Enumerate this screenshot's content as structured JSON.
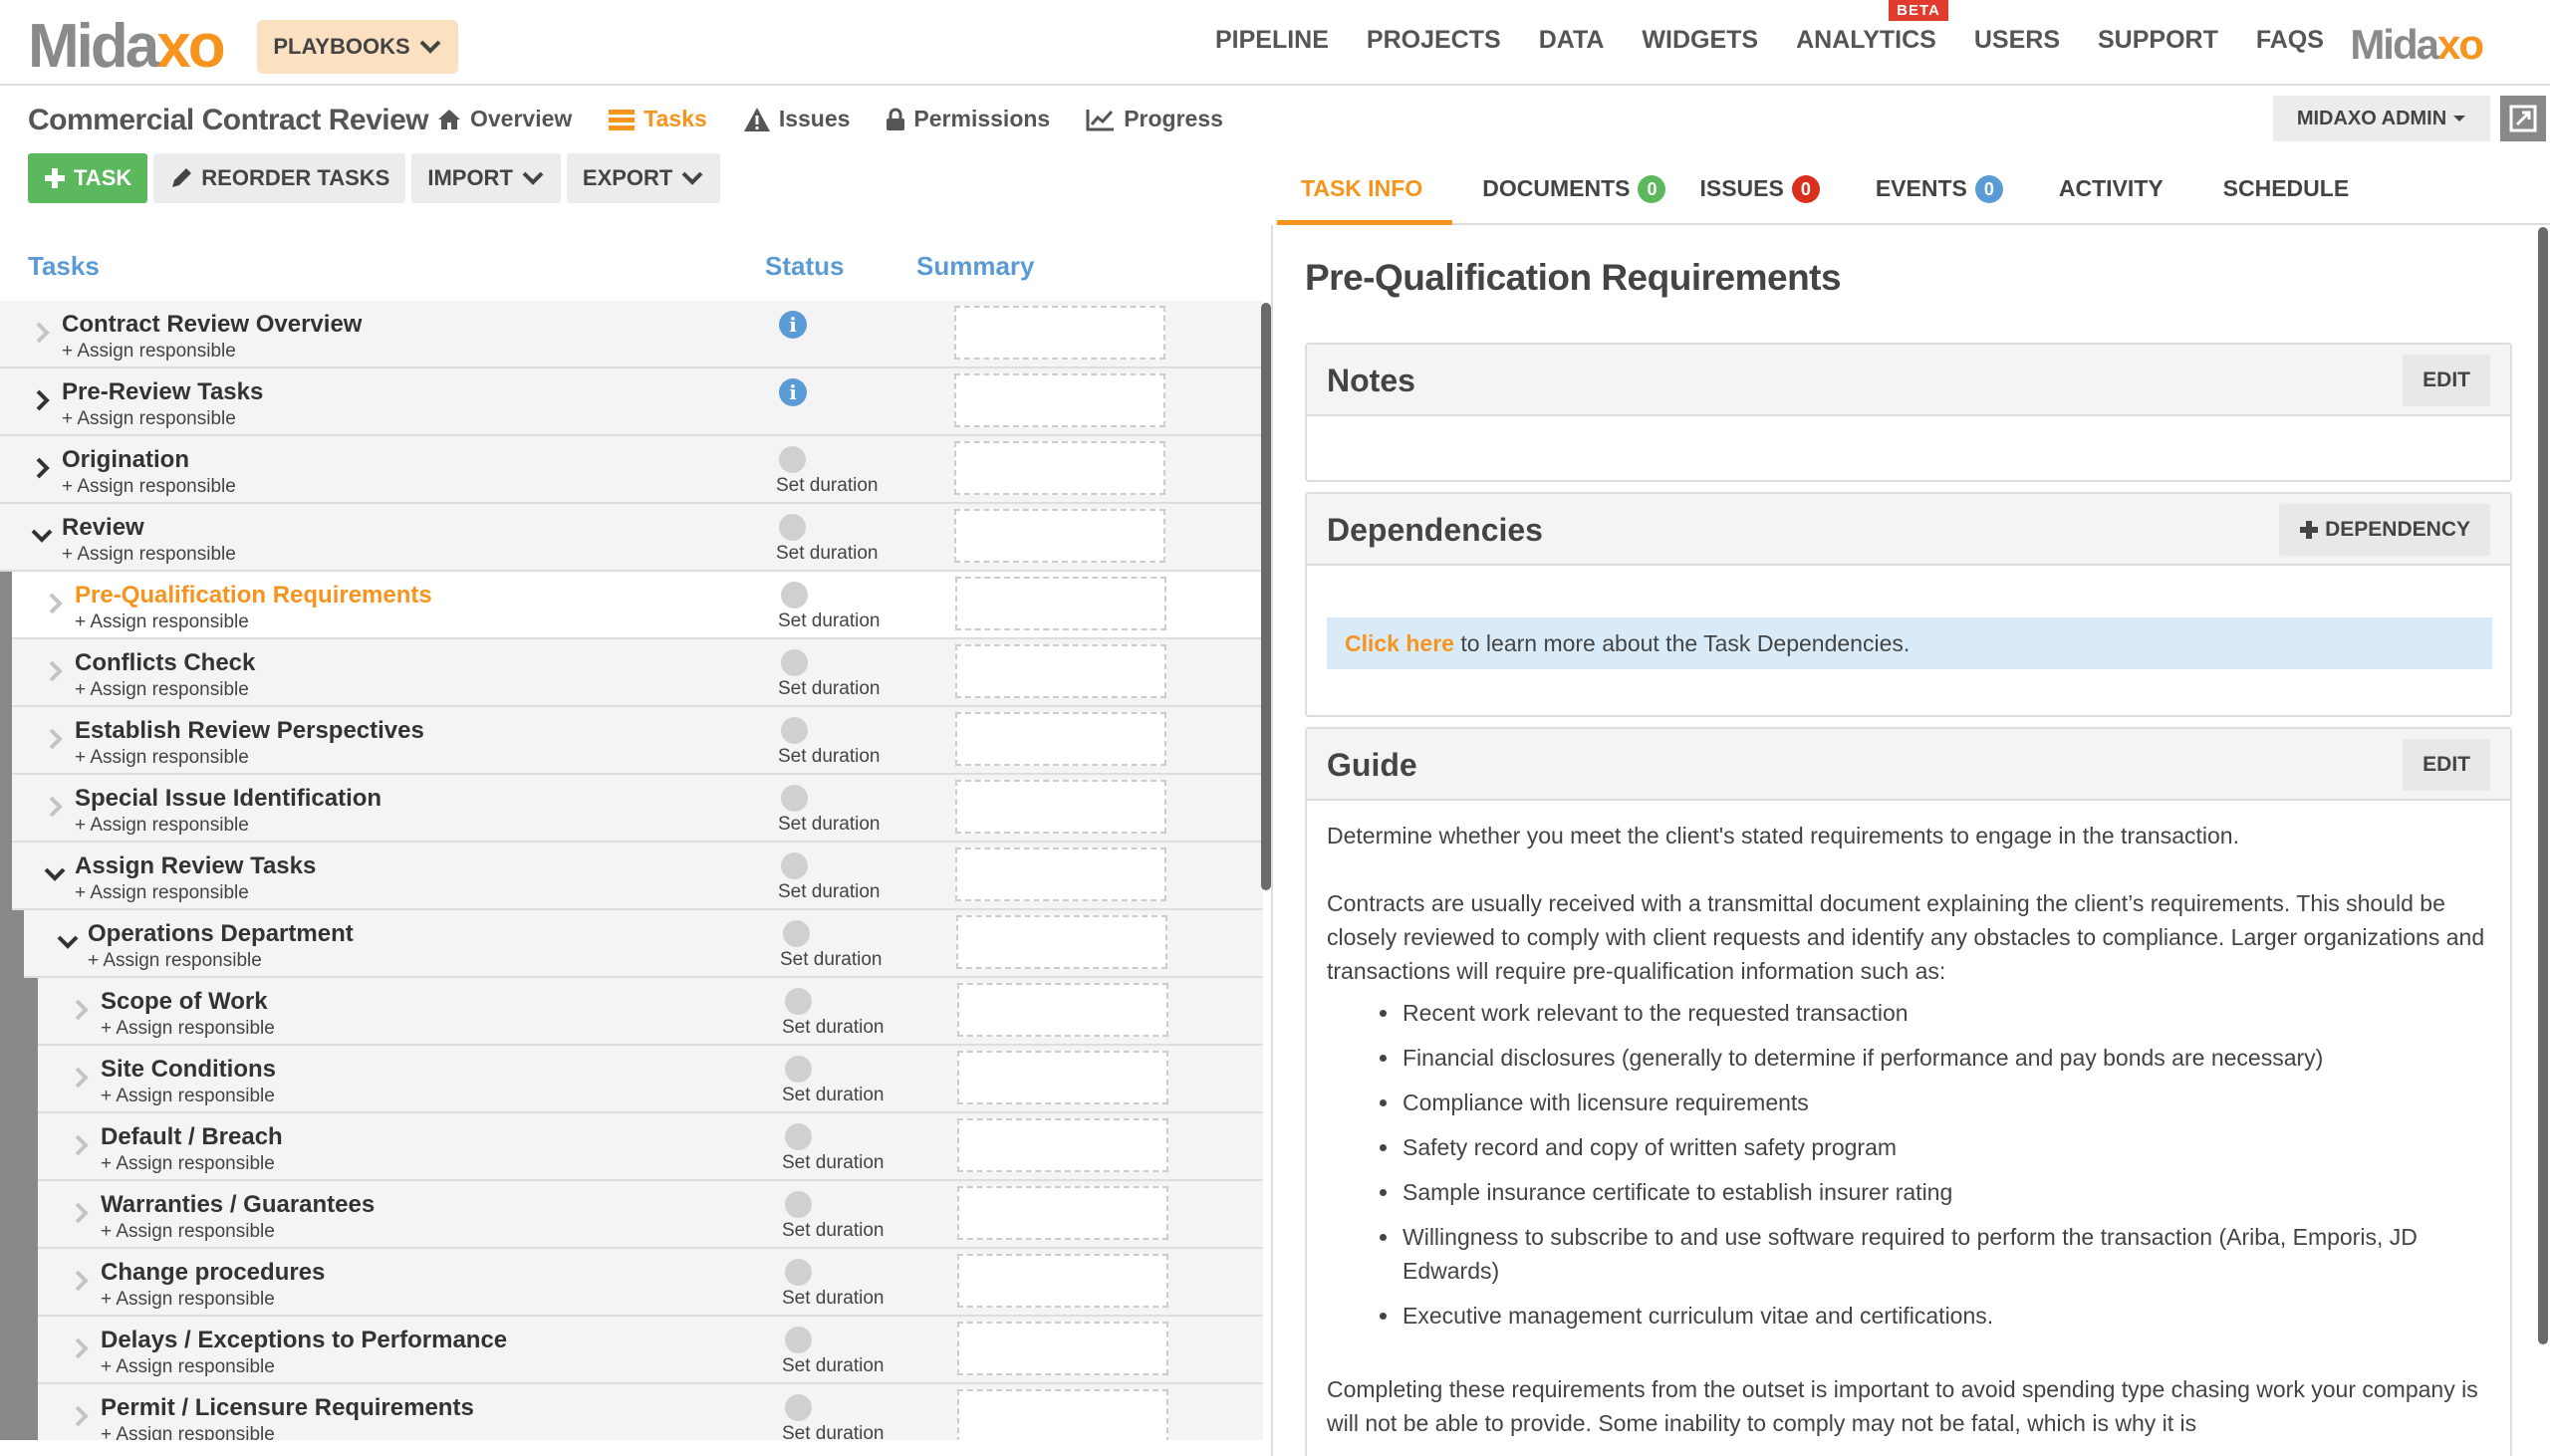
{
  "header": {
    "logo": {
      "main": "Mida",
      "accent": "xo"
    },
    "playbooks_label": "PLAYBOOKS",
    "nav": [
      "PIPELINE",
      "PROJECTS",
      "DATA",
      "WIDGETS",
      "ANALYTICS",
      "USERS",
      "SUPPORT",
      "FAQS"
    ],
    "beta_label": "BETA",
    "logo_right": {
      "main": "Mida",
      "accent": "xo"
    }
  },
  "project": {
    "title": "Commercial Contract Review",
    "tabs": [
      "Overview",
      "Tasks",
      "Issues",
      "Permissions",
      "Progress"
    ],
    "admin_label": "MIDAXO ADMIN"
  },
  "toolbar": {
    "task_label": "TASK",
    "reorder_label": "REORDER TASKS",
    "import_label": "IMPORT",
    "export_label": "EXPORT"
  },
  "columns": {
    "tasks": "Tasks",
    "status": "Status",
    "summary": "Summary"
  },
  "tasks": [
    {
      "name": "Contract Review Overview",
      "assign": "+ Assign responsible",
      "duration": ""
    },
    {
      "name": "Pre-Review Tasks",
      "assign": "+ Assign responsible",
      "duration": ""
    },
    {
      "name": "Origination",
      "assign": "+ Assign responsible",
      "duration": "Set duration"
    },
    {
      "name": "Review",
      "assign": "+ Assign responsible",
      "duration": "Set duration"
    },
    {
      "name": "Pre-Qualification Requirements",
      "assign": "+ Assign responsible",
      "duration": "Set duration"
    },
    {
      "name": "Conflicts Check",
      "assign": "+ Assign responsible",
      "duration": "Set duration"
    },
    {
      "name": "Establish Review Perspectives",
      "assign": "+ Assign responsible",
      "duration": "Set duration"
    },
    {
      "name": "Special Issue Identification",
      "assign": "+ Assign responsible",
      "duration": "Set duration"
    },
    {
      "name": "Assign Review Tasks",
      "assign": "+ Assign responsible",
      "duration": "Set duration"
    },
    {
      "name": "Operations Department",
      "assign": "+ Assign responsible",
      "duration": "Set duration"
    },
    {
      "name": "Scope of Work",
      "assign": "+ Assign responsible",
      "duration": "Set duration"
    },
    {
      "name": "Site Conditions",
      "assign": "+ Assign responsible",
      "duration": "Set duration"
    },
    {
      "name": "Default / Breach",
      "assign": "+ Assign responsible",
      "duration": "Set duration"
    },
    {
      "name": "Warranties / Guarantees",
      "assign": "+ Assign responsible",
      "duration": "Set duration"
    },
    {
      "name": "Change procedures",
      "assign": "+ Assign responsible",
      "duration": "Set duration"
    },
    {
      "name": "Delays / Exceptions to Performance",
      "assign": "+ Assign responsible",
      "duration": "Set duration"
    },
    {
      "name": "Permit / Licensure Requirements",
      "assign": "+ Assign responsible",
      "duration": "Set duration"
    }
  ],
  "right_tabs": [
    {
      "label": "TASK INFO",
      "badge": ""
    },
    {
      "label": "DOCUMENTS",
      "badge": "0"
    },
    {
      "label": "ISSUES",
      "badge": "0"
    },
    {
      "label": "EVENTS",
      "badge": "0"
    },
    {
      "label": "ACTIVITY",
      "badge": ""
    },
    {
      "label": "SCHEDULE",
      "badge": ""
    }
  ],
  "badge_colors": {
    "documents": "#5cb85c",
    "issues": "#d9301e",
    "events": "#5b9bd5"
  },
  "detail": {
    "title": "Pre-Qualification Requirements",
    "notes_title": "Notes",
    "edit_label": "EDIT",
    "dependencies_title": "Dependencies",
    "dependency_button": "DEPENDENCY",
    "dep_link": "Click here",
    "dep_text": " to learn more about the Task Dependencies.",
    "guide_title": "Guide",
    "guide_p1": "Determine whether you meet the client's stated requirements to engage in the transaction.",
    "guide_p2": "Contracts are usually received with a transmittal document explaining the client’s requirements. This should be closely reviewed to comply with client requests and identify any obstacles to compliance. Larger organizations and transactions will require pre-qualification information such as:",
    "guide_list": [
      "Recent work relevant to the requested transaction",
      "Financial disclosures (generally to determine if performance and pay bonds are necessary)",
      "Compliance with licensure requirements",
      "Safety record and copy of written safety program",
      "Sample insurance certificate to establish insurer rating",
      "Willingness to subscribe to and use software required to perform the transaction (Ariba, Emporis, JD Edwards)",
      "Executive management curriculum vitae and certifications."
    ],
    "guide_p3": "Completing these requirements from the outset is important to avoid spending type chasing work your company is will not be able to provide. Some inability to comply may not be fatal, which is why it is"
  },
  "colors": {
    "accent": "#f7941d",
    "link_blue": "#5b9bd5",
    "green": "#5cb85c"
  }
}
